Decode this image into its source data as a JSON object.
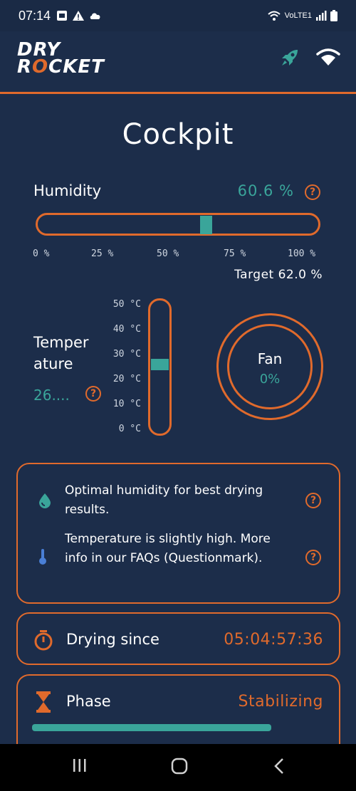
{
  "status": {
    "time": "07:14",
    "left_icons": [
      "gallery-notification-icon",
      "warning-icon",
      "cloud-icon"
    ],
    "right_icons": [
      "wifi-calling-icon",
      "lte-signal-icon",
      "battery-icon"
    ],
    "network_label": "VoLTE1"
  },
  "header": {
    "logo_line1": "DRY",
    "logo_line2_a": "R",
    "logo_line2_b": "O",
    "logo_line2_c": "CKET",
    "icons": [
      "rocket-icon",
      "wifi-icon"
    ]
  },
  "page_title": "Cockpit",
  "humidity": {
    "label": "Humidity",
    "value": "60.6 %",
    "level_percent": 60.6,
    "ticks": [
      "0 %",
      "25 %",
      "50 %",
      "75 %",
      "100 %"
    ],
    "target": "Target 62.0 %"
  },
  "temperature": {
    "label": "Temper ature",
    "value": "26....",
    "level_celsius": 26,
    "ticks": [
      "50 °C",
      "40 °C",
      "30 °C",
      "20 °C",
      "10 °C",
      "0 °C"
    ]
  },
  "fan": {
    "label": "Fan",
    "value": "0%"
  },
  "info": {
    "items": [
      {
        "icon": "droplet-icon",
        "text": "Optimal humidity for best drying results."
      },
      {
        "icon": "thermometer-icon",
        "text": "Temperature is slightly high. More info in our FAQs (Questionmark)."
      }
    ]
  },
  "drying": {
    "label": "Drying since",
    "value": "05:04:57:36"
  },
  "phase": {
    "label": "Phase",
    "value": "Stabilizing",
    "progress_percent": 80
  },
  "help_glyph": "?",
  "colors": {
    "background": "#1c2d4a",
    "accent": "#e06a2c",
    "teal": "#3aa59a"
  }
}
